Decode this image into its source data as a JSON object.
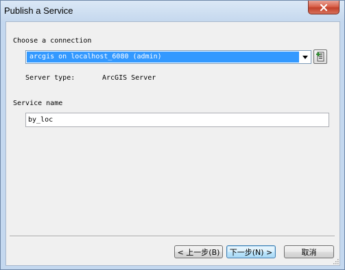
{
  "window": {
    "title": "Publish a Service"
  },
  "connection": {
    "label": "Choose a connection",
    "selected": "arcgis on localhost_6080 (admin)",
    "server_type_label": "Server type:",
    "server_type_value": "ArcGIS Server"
  },
  "service": {
    "label": "Service name",
    "value": "by_loc"
  },
  "buttons": {
    "back": "< 上一步(B)",
    "next": "下一步(N) >",
    "cancel": "取消"
  },
  "colors": {
    "selection": "#3399ff",
    "close_button": "#c9483a",
    "dialog_background": "#f0f0f0"
  },
  "icons": {
    "close": "close-icon",
    "dropdown": "chevron-down-icon",
    "add_connection": "add-server-connection-icon"
  }
}
